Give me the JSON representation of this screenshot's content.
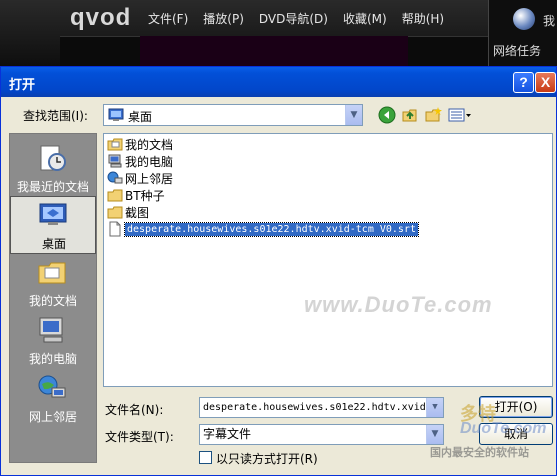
{
  "background_app": {
    "logo": "qvod",
    "menu": [
      "文件(F)",
      "播放(P)",
      "DVD导航(D)",
      "收藏(M)",
      "帮助(H)"
    ],
    "right_text": "我",
    "task_label": "网络任务"
  },
  "dialog": {
    "title": "打开",
    "help_glyph": "?",
    "close_glyph": "X",
    "look_in_label": "查找范围(I):",
    "look_in_value": "桌面",
    "toolbar_icons": [
      "back-icon",
      "up-folder-icon",
      "new-folder-icon",
      "view-menu-icon"
    ],
    "places": [
      {
        "label": "我最近的文档",
        "icon": "recent-documents-icon"
      },
      {
        "label": "桌面",
        "icon": "desktop-icon",
        "active": true
      },
      {
        "label": "我的文档",
        "icon": "my-documents-icon"
      },
      {
        "label": "我的电脑",
        "icon": "my-computer-icon"
      },
      {
        "label": "网上邻居",
        "icon": "network-places-icon"
      }
    ],
    "files": [
      {
        "name": "我的文档",
        "icon": "my-documents-icon"
      },
      {
        "name": "我的电脑",
        "icon": "my-computer-icon"
      },
      {
        "name": "网上邻居",
        "icon": "network-places-icon"
      },
      {
        "name": "BT种子",
        "icon": "folder-icon"
      },
      {
        "name": "截图",
        "icon": "folder-icon"
      },
      {
        "name": "desperate.housewives.s01e22.hdtv.xvid-tcm V0.srt",
        "icon": "file-icon",
        "selected": true
      }
    ],
    "watermark": "www.DuoTe.com",
    "filename_label": "文件名(N):",
    "filename_value": "desperate.housewives.s01e22.hdtv.xvid",
    "filetype_label": "文件类型(T):",
    "filetype_value": "字幕文件",
    "readonly_label": "以只读方式打开(R)",
    "open_button": "打开(O)",
    "cancel_button": "取消"
  },
  "corner_logo": {
    "line1": "多特",
    "line2": "DuoTe.com",
    "line3": "国内最安全的软件站"
  },
  "colors": {
    "titlebar": "#0250d8",
    "dialog_bg": "#ece9d8",
    "places_bg": "#8c8c8c",
    "selection": "#316ac5"
  }
}
